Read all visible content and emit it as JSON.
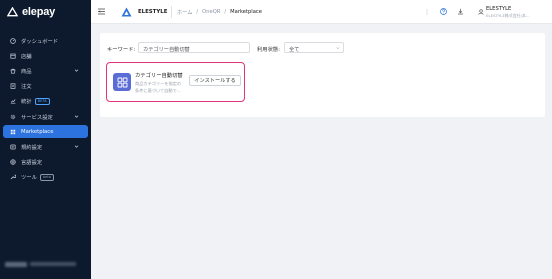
{
  "brand": {
    "logo_text": "elepay",
    "accent": "#2d73df",
    "sidebar_bg": "#0d1a2e",
    "highlight": "#e2337e"
  },
  "sidebar": {
    "items": [
      {
        "label": "ダッシュボード",
        "icon": "dashboard-icon"
      },
      {
        "label": "店舗",
        "icon": "store-icon"
      },
      {
        "label": "商品",
        "icon": "product-icon",
        "expandable": true
      },
      {
        "label": "注文",
        "icon": "order-icon"
      },
      {
        "label": "統計",
        "icon": "stats-icon",
        "badge": "BETA"
      },
      {
        "label": "サービス設定",
        "icon": "gear-icon",
        "expandable": true
      },
      {
        "label": "Marketplace",
        "icon": "marketplace-icon",
        "active": true
      },
      {
        "label": "規約設定",
        "icon": "terms-icon",
        "expandable": true
      },
      {
        "label": "言語設定",
        "icon": "language-icon"
      },
      {
        "label": "ツール",
        "icon": "tool-icon",
        "badge": "beta"
      }
    ]
  },
  "header": {
    "app_name": "ELESTYLE",
    "breadcrumb": [
      "ホーム",
      "OneQR",
      "Marketplace"
    ],
    "separator": "/",
    "user_name": "ELESTYLE",
    "user_company": "ELESTYLE株式会社(本..."
  },
  "filters": {
    "keyword_label": "キーワード:",
    "keyword_value": "カテゴリー自動切替",
    "status_label": "利用状態:",
    "status_value": "全て"
  },
  "apps": [
    {
      "title": "カテゴリー自動切替",
      "description_line1": "商品カテゴリーを指定の",
      "description_line2": "条件に基づいて自動で...",
      "install_label": "インストールする",
      "icon": "grid-icon"
    }
  ]
}
